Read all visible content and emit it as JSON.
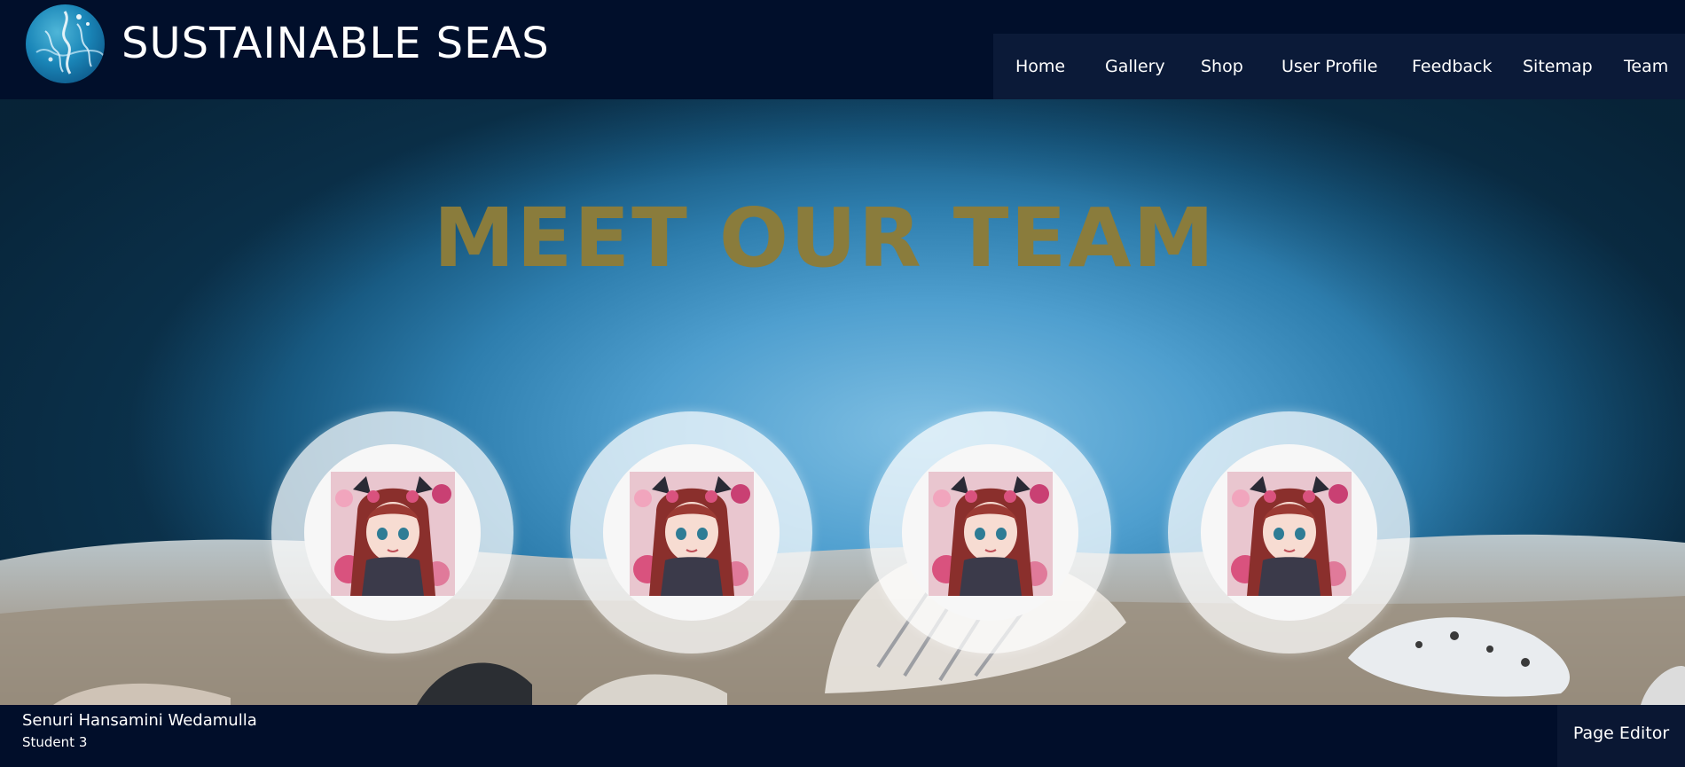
{
  "header": {
    "brand": "SUSTAINABLE SEAS",
    "nav": [
      {
        "label": "Home"
      },
      {
        "label": "Gallery"
      },
      {
        "label": "Shop"
      },
      {
        "label": "User Profile"
      },
      {
        "label": "Feedback"
      },
      {
        "label": "Sitemap"
      },
      {
        "label": "Team"
      }
    ]
  },
  "hero": {
    "title": "MEET OUR TEAM",
    "members": [
      {
        "icon": "avatar-portrait"
      },
      {
        "icon": "avatar-portrait"
      },
      {
        "icon": "avatar-portrait"
      },
      {
        "icon": "avatar-portrait"
      }
    ]
  },
  "footer": {
    "name": "Senuri Hansamini Wedamulla",
    "role": "Student 3",
    "editor_label": "Page Editor"
  },
  "colors": {
    "header_bg": "#010f2b",
    "nav_bg": "#0b1a38",
    "title": "#8a7c3c",
    "footer_bg": "#010e2a"
  }
}
